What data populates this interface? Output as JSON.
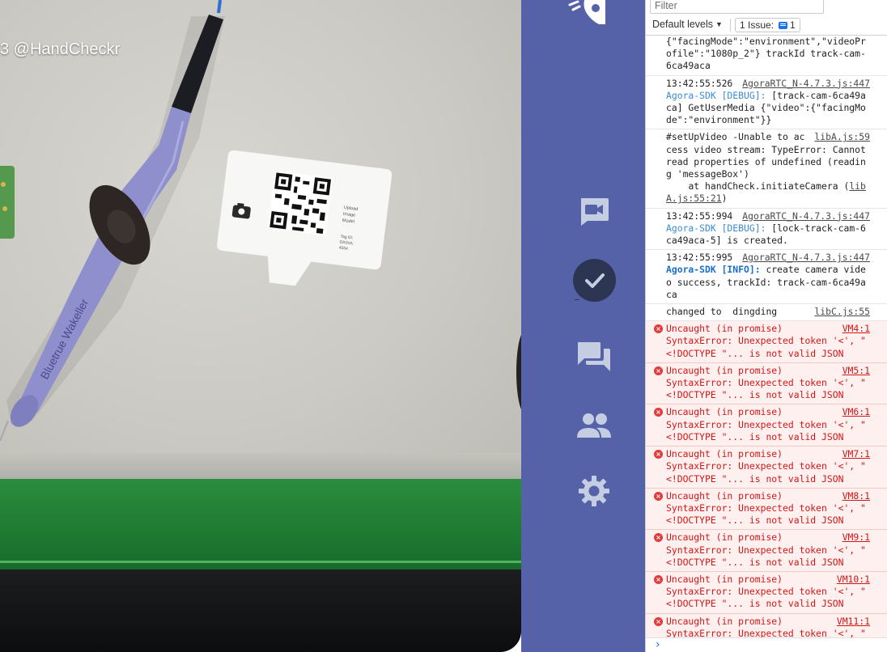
{
  "camera": {
    "watermark": "3 @HandCheckr",
    "card": {
      "title_line1": "Upload",
      "title_line2": "Image",
      "title_line3": "Model",
      "tag_line1": "Tag ID:",
      "tag_line2": "DR3VA",
      "tag_line3": "4554"
    },
    "pen_brand": "Bluetrue Wakeller"
  },
  "sidebar": {
    "items": [
      {
        "name": "video-call",
        "icon": "video-camera-icon"
      },
      {
        "name": "check",
        "icon": "check-icon",
        "active": true
      },
      {
        "name": "chat",
        "icon": "chat-icon"
      },
      {
        "name": "participants",
        "icon": "people-icon"
      },
      {
        "name": "settings",
        "icon": "gear-icon"
      }
    ],
    "colors": {
      "background": "#5562a8",
      "icon": "#c5cde3",
      "active": "#2c3552"
    }
  },
  "console": {
    "filter_placeholder": "Filter",
    "levels_label": "Default levels",
    "issues_label": "1 Issue:",
    "issues_count": "1",
    "messages": [
      {
        "type": "log",
        "text": "{\"facingMode\":\"environment\",\"videoProfile\":\"1080p_2\"} trackId track-cam-6ca49aca"
      },
      {
        "type": "log",
        "time": "13:42:55:526",
        "source": "AgoraRTC_N-4.7.3.js:447",
        "tag": "Agora-SDK [DEBUG]:",
        "text": " [track-cam-6ca49aca] GetUserMedia {\"video\":{\"facingMode\":\"environment\"}}"
      },
      {
        "type": "log",
        "source": "libA.js:59",
        "text": "#setUpVideo -Unable to access video stream: TypeError: Cannot read properties of undefined (reading 'messageBox')\n    at handCheck.initiateCamera (",
        "link": "libA.js:55:21",
        "tail": ")"
      },
      {
        "type": "log",
        "time": "13:42:55:994",
        "source": "AgoraRTC_N-4.7.3.js:447",
        "tag": "Agora-SDK [DEBUG]:",
        "text": " [lock-track-cam-6ca49aca-5] is created."
      },
      {
        "type": "log",
        "time": "13:42:55:995",
        "source": "AgoraRTC_N-4.7.3.js:447",
        "tag": "Agora-SDK [INFO]:",
        "text": " create camera video success, trackId: track-cam-6ca49aca"
      },
      {
        "type": "log",
        "source": "libC.js:55",
        "text": "changed to  dingding"
      },
      {
        "type": "error",
        "source": "VM4:1",
        "line1": "Uncaught (in promise)",
        "line2": "SyntaxError: Unexpected token '<', \"<!DOCTYPE \"... is not valid JSON"
      },
      {
        "type": "error",
        "source": "VM5:1",
        "line1": "Uncaught (in promise)",
        "line2": "SyntaxError: Unexpected token '<', \"<!DOCTYPE \"... is not valid JSON"
      },
      {
        "type": "error",
        "source": "VM6:1",
        "line1": "Uncaught (in promise)",
        "line2": "SyntaxError: Unexpected token '<', \"<!DOCTYPE \"... is not valid JSON"
      },
      {
        "type": "error",
        "source": "VM7:1",
        "line1": "Uncaught (in promise)",
        "line2": "SyntaxError: Unexpected token '<', \"<!DOCTYPE \"... is not valid JSON"
      },
      {
        "type": "error",
        "source": "VM8:1",
        "line1": "Uncaught (in promise)",
        "line2": "SyntaxError: Unexpected token '<', \"<!DOCTYPE \"... is not valid JSON"
      },
      {
        "type": "error",
        "source": "VM9:1",
        "line1": "Uncaught (in promise)",
        "line2": "SyntaxError: Unexpected token '<', \"<!DOCTYPE \"... is not valid JSON"
      },
      {
        "type": "error",
        "source": "VM10:1",
        "line1": "Uncaught (in promise)",
        "line2": "SyntaxError: Unexpected token '<', \"<!DOCTYPE \"... is not valid JSON"
      },
      {
        "type": "error",
        "source": "VM11:1",
        "line1": "Uncaught (in promise)",
        "line2": "SyntaxError: Unexpected token '<', \"<!DOCTYPE \"... is not valid JSON"
      }
    ],
    "prompt_symbol": "›"
  }
}
